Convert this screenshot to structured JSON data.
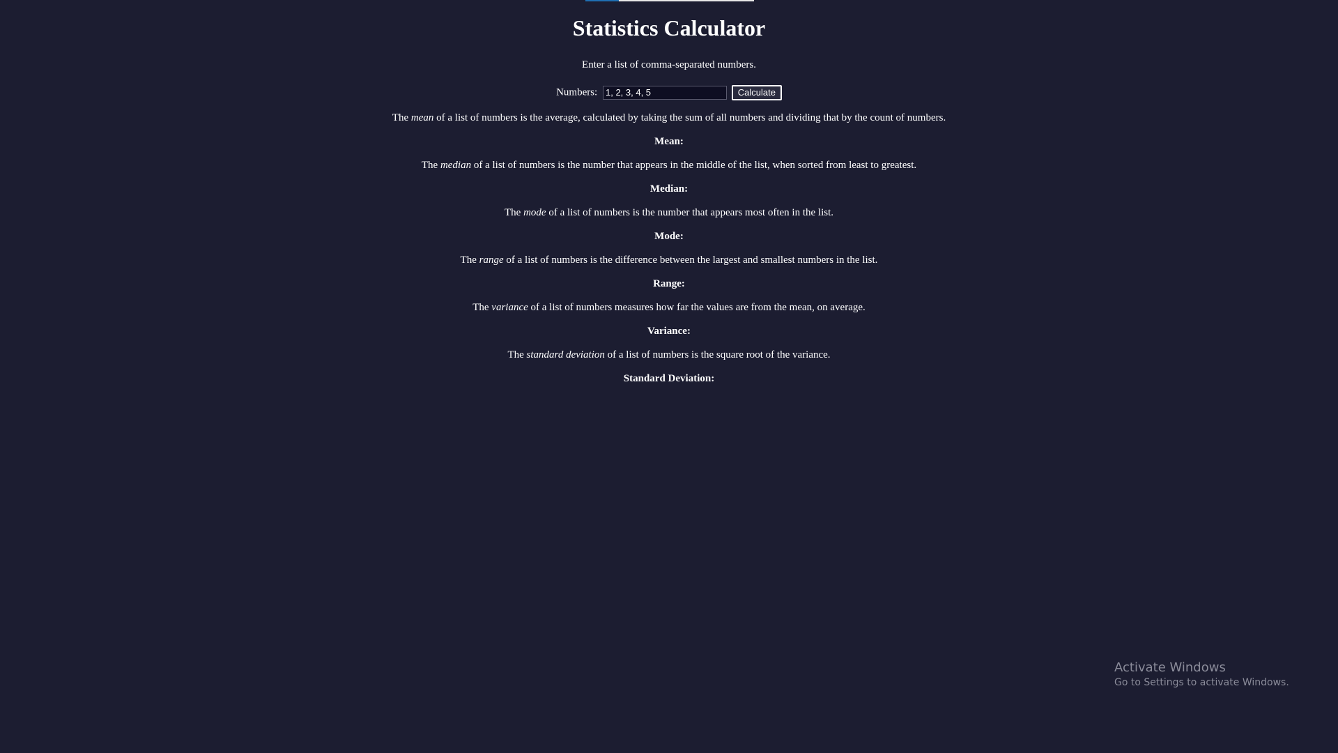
{
  "page": {
    "title": "Statistics Calculator",
    "intro": "Enter a list of comma-separated numbers."
  },
  "form": {
    "label": "Numbers:",
    "input_value": "1, 2, 3, 4, 5",
    "button_label": "Calculate"
  },
  "sections": {
    "mean": {
      "pre": "The ",
      "term": "mean",
      "post": " of a list of numbers is the average, calculated by taking the sum of all numbers and dividing that by the count of numbers.",
      "label": "Mean:"
    },
    "median": {
      "pre": "The ",
      "term": "median",
      "post": " of a list of numbers is the number that appears in the middle of the list, when sorted from least to greatest.",
      "label": "Median:"
    },
    "mode": {
      "pre": "The ",
      "term": "mode",
      "post": " of a list of numbers is the number that appears most often in the list.",
      "label": "Mode:"
    },
    "range": {
      "pre": "The ",
      "term": "range",
      "post": " of a list of numbers is the difference between the largest and smallest numbers in the list.",
      "label": "Range:"
    },
    "variance": {
      "pre": "The ",
      "term": "variance",
      "post": " of a list of numbers measures how far the values are from the mean, on average.",
      "label": "Variance:"
    },
    "stddev": {
      "pre": "The ",
      "term": "standard deviation",
      "post": " of a list of numbers is the square root of the variance.",
      "label": "Standard Deviation:"
    }
  },
  "watermark": {
    "title": "Activate Windows",
    "subtitle": "Go to Settings to activate Windows."
  },
  "colors": {
    "background": "#1c1d31",
    "text": "#ffffff",
    "input_background": "#0e0e22",
    "watermark": "#8a8b99"
  }
}
